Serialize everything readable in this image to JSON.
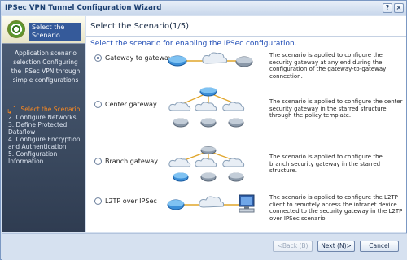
{
  "window": {
    "title": "IPSec VPN Tunnel Configuration Wizard",
    "help_label": "?",
    "close_label": "×"
  },
  "sidebar": {
    "header": "Select the Scenario",
    "intro": "Application scenario selection Configuring the IPSec VPN through simple configurations",
    "steps": [
      {
        "label": "1. Select the Scenario",
        "active": true
      },
      {
        "label": "2. Configure Networks",
        "active": false
      },
      {
        "label": "3. Define Protected Dataflow",
        "active": false
      },
      {
        "label": "4. Configure Encryption and Authentication",
        "active": false
      },
      {
        "label": "5. Configuration Information",
        "active": false
      }
    ]
  },
  "main": {
    "title": "Select the Scenario(1/5)",
    "subtitle": "Select the scenario for enabling the IPSec configuration.",
    "options": [
      {
        "label": "Gateway to gateway",
        "checked": true,
        "description": "The scenario is applied to configure the security gateway at any end during the configuration of the gateway-to-gateway connection."
      },
      {
        "label": "Center gateway",
        "checked": false,
        "description": "The scenario is applied to configure the center security gateway in the starred structure through the policy template."
      },
      {
        "label": "Branch gateway",
        "checked": false,
        "description": "The scenario is applied to configure the branch security gateway in the starred structure."
      },
      {
        "label": "L2TP over IPSec",
        "checked": false,
        "description": "The scenario is applied to configure the L2TP client to remotely access the intranet device connected to the security gateway in the L2TP over IPSec scenario."
      }
    ]
  },
  "footer": {
    "back_label": "<Back (B)",
    "next_label": "Next (N)>",
    "cancel_label": "Cancel"
  },
  "colors": {
    "accent": "#1f4cb5",
    "active_step": "#ff8a1f",
    "sidebar_bg": "#3b4a60"
  }
}
